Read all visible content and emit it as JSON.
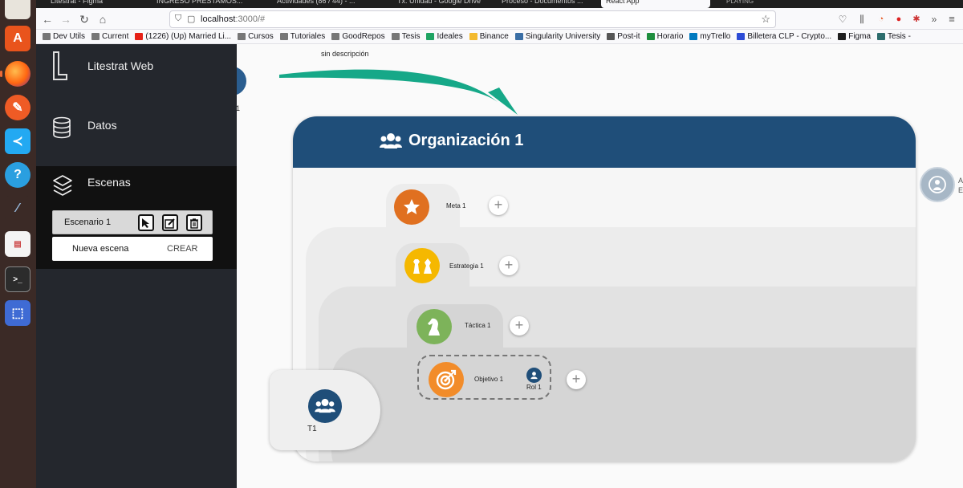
{
  "browser": {
    "tabs": [
      {
        "label": "Litestrat - Figma"
      },
      {
        "label": "INGRESO PRESTAMOS..."
      },
      {
        "label": "Actividades (86 / 44) - ..."
      },
      {
        "label": "Tx. Unidad - Google Drive"
      },
      {
        "label": "Proceso - Documentos ..."
      },
      {
        "label": "React App"
      },
      {
        "label": "PLAYING"
      }
    ],
    "url_host": "localhost",
    "url_rest": ":3000/#",
    "bookmarks": [
      {
        "label": "Dev Utils",
        "color": "#777777"
      },
      {
        "label": "Current",
        "color": "#777777"
      },
      {
        "label": "(1226) (Up) Married Li...",
        "color": "#e62117"
      },
      {
        "label": "Cursos",
        "color": "#777777"
      },
      {
        "label": "Tutoriales",
        "color": "#777777"
      },
      {
        "label": "GoodRepos",
        "color": "#777777"
      },
      {
        "label": "Tesis",
        "color": "#777777"
      },
      {
        "label": "Ideales",
        "color": "#1fa463"
      },
      {
        "label": "Binance",
        "color": "#f3ba2f"
      },
      {
        "label": "Singularity University",
        "color": "#3a6ea5"
      },
      {
        "label": "Post-it",
        "color": "#555555"
      },
      {
        "label": "Horario",
        "color": "#1e8e3e"
      },
      {
        "label": "myTrello",
        "color": "#0079bf"
      },
      {
        "label": "Billetera CLP - Crypto...",
        "color": "#2c4bd6"
      },
      {
        "label": "Figma",
        "color": "#1e1e1e"
      },
      {
        "label": "Tesis -",
        "color": "#2d6d6d"
      }
    ]
  },
  "sidebar": {
    "app_title": "Litestrat Web",
    "datos_label": "Datos",
    "escenas_label": "Escenas",
    "scenario_name": "Escenario 1",
    "new_scene_placeholder": "Nueva escena",
    "create_label": "CREAR"
  },
  "canvas": {
    "arrow_label": "sin descripción",
    "org_title": "Organización 1",
    "right_node_text_1": "A",
    "right_node_text_2": "E",
    "left_node_fragment": "1",
    "team_label": "T1",
    "nodes": {
      "meta": "Meta 1",
      "estrategia": "Estrategia 1",
      "tactica": "Táctica 1",
      "objetivo": "Objetivo 1",
      "rol": "Rol 1"
    },
    "plus": "+"
  },
  "colors": {
    "org_header": "#1f4e79",
    "meta": "#e07020",
    "estrategia": "#f5b800",
    "tactica": "#7db35a",
    "objetivo": "#f28c2a",
    "arrow": "#16a888"
  }
}
